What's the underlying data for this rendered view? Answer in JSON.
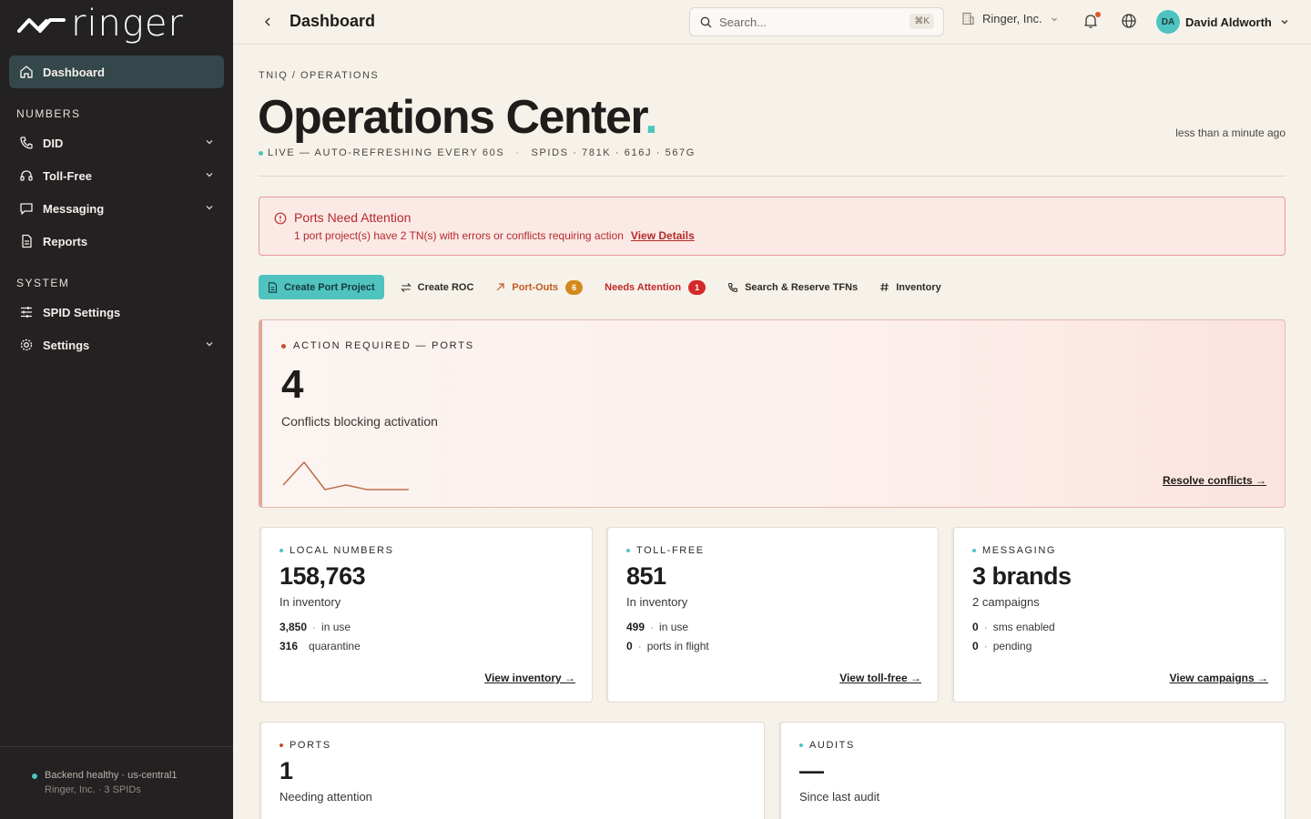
{
  "brand": {
    "name": "ringer",
    "accent": "#4fc3c0"
  },
  "sidebar": {
    "dashboard": "Dashboard",
    "section_numbers": "NUMBERS",
    "did": "DID",
    "toll_free": "Toll-Free",
    "messaging": "Messaging",
    "reports": "Reports",
    "section_system": "SYSTEM",
    "spid_settings": "SPID Settings",
    "settings": "Settings",
    "footer_status": "Backend healthy · us-central1",
    "footer_org": "Ringer, Inc. · 3 SPIDs"
  },
  "topbar": {
    "title": "Dashboard",
    "search_placeholder": "Search...",
    "search_shortcut": "⌘K",
    "org": "Ringer, Inc.",
    "user_initials": "DA",
    "user_name": "David Aldworth"
  },
  "main": {
    "breadcrumb": "TNIQ / OPERATIONS",
    "title": "Operations Center",
    "title_suffix": ".",
    "live": "LIVE — AUTO-REFRESHING EVERY 60S",
    "spids": "SPIDS · 781K · 616J · 567G",
    "updated": "less than a minute ago"
  },
  "alert": {
    "title": "Ports Need Attention",
    "text": "1 port project(s) have 2 TN(s) with errors or conflicts requiring action",
    "link": "View Details"
  },
  "actions": {
    "create_port": "Create Port Project",
    "create_roc": "Create ROC",
    "port_outs": "Port-Outs",
    "port_outs_count": "6",
    "needs_attention": "Needs Attention",
    "needs_attention_count": "1",
    "search_reserve": "Search & Reserve TFNs",
    "inventory": "Inventory"
  },
  "action_card": {
    "label": "ACTION REQUIRED — PORTS",
    "value": "4",
    "desc": "Conflicts blocking activation",
    "link": "Resolve conflicts →",
    "sparkline": [
      1,
      6,
      0,
      1,
      0,
      0,
      0
    ]
  },
  "cards": {
    "local": {
      "label": "LOCAL NUMBERS",
      "value": "158,763",
      "sub": "In inventory",
      "row1_num": "3,850",
      "row1_text": "in use",
      "row2_num": "316",
      "row2_text": "quarantine",
      "link": "View inventory →"
    },
    "tollfree": {
      "label": "TOLL-FREE",
      "value": "851",
      "sub": "In inventory",
      "row1_num": "499",
      "row1_text": "in use",
      "row2_num": "0",
      "row2_text": "ports in flight",
      "link": "View toll-free →"
    },
    "messaging": {
      "label": "MESSAGING",
      "value": "3 brands",
      "sub": "2 campaigns",
      "row1_num": "0",
      "row1_text": "sms enabled",
      "row2_num": "0",
      "row2_text": "pending",
      "link": "View campaigns →"
    },
    "ports": {
      "label": "PORTS",
      "value": "1",
      "sub": "Needing attention"
    },
    "audits": {
      "label": "AUDITS",
      "value": "—",
      "sub": "Since last audit"
    }
  }
}
